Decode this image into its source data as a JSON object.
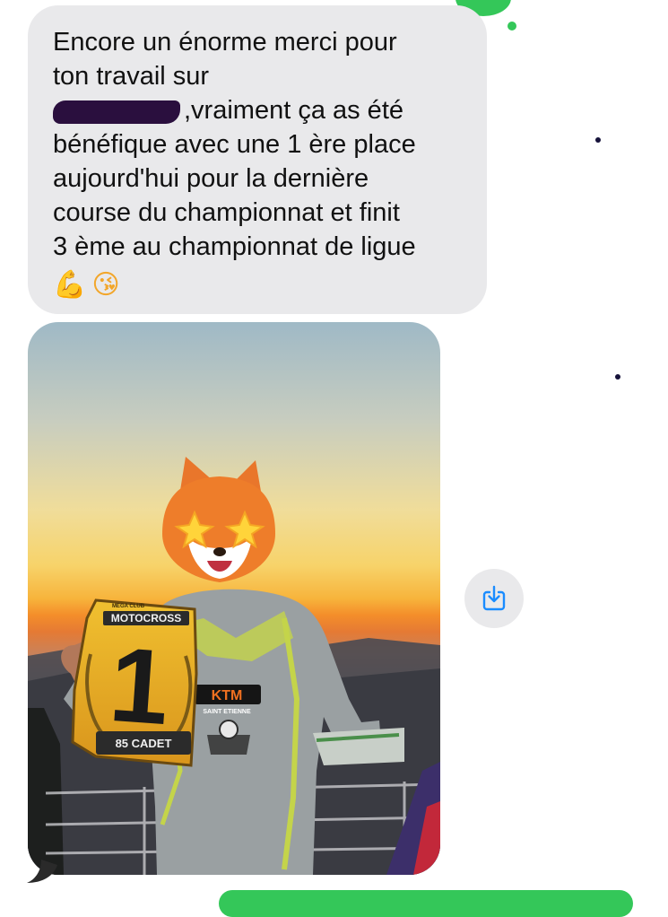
{
  "message": {
    "lines": [
      "Encore un énorme merci pour",
      "ton travail sur",
      ",vraiment ça as été",
      "bénéfique avec une 1 ère place",
      "aujourd'hui pour la dernière",
      "course du championnat et finit",
      "3 ème au championnat de ligue"
    ],
    "emojis": [
      "💪",
      "😘"
    ]
  },
  "photo": {
    "sign_brand": "MOTOCROSS",
    "sign_top": "MEGA CLUB",
    "sign_number": "1",
    "sign_category": "85 CADET",
    "shirt_brand": "KTM",
    "shirt_sub": "SAINT ETIENNE"
  },
  "icons": {
    "save": "download-to-photos-icon",
    "emoji_arm": "flexed-biceps-emoji",
    "emoji_kiss": "face-blowing-kiss-emoji",
    "mask": "fox-star-eyes-memoji"
  },
  "colors": {
    "received_bubble": "#e9e9eb",
    "sent_bubble": "#34c759",
    "accent": "#1a8cff"
  }
}
